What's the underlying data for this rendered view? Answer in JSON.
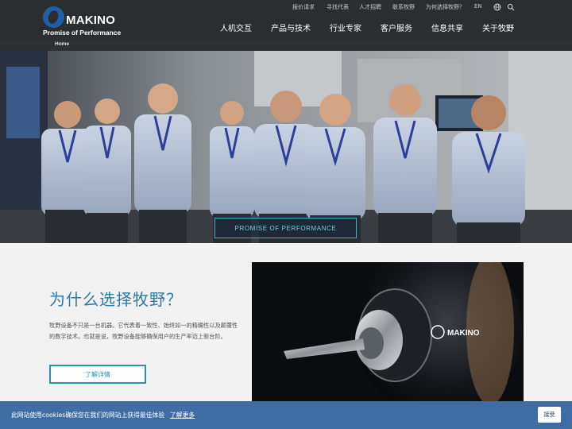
{
  "header": {
    "logo_word": "MAKINO",
    "logo_tagline": "Promise of Performance",
    "utility_links": [
      "报价请求",
      "寻找代表",
      "人才招聘",
      "联系牧野",
      "为何选择牧野？"
    ],
    "language": "EN",
    "main_nav": [
      "人机交互",
      "产品与技术",
      "行业专家",
      "客户服务",
      "信息共享",
      "关于牧野"
    ]
  },
  "breadcrumb": {
    "home": "Home"
  },
  "hero": {
    "button_label": "PROMISE OF PERFORMANCE"
  },
  "content": {
    "title": "为什么选择牧野？",
    "body": "牧野设备不只是一台机器。它代表着一致性、始终如一的精确性以及颠覆性的数字技术。也就是说，牧野设备能够确保用户的生产率迈上新台阶。",
    "button_label": "了解详情",
    "product_brand": "MAKINO"
  },
  "cookie": {
    "text": "此网站使用cookies确保您在我们的网站上获得最佳体验",
    "link": "了解更多",
    "accept": "接受"
  },
  "colors": {
    "header_bg": "#2b2e31",
    "accent_blue": "#2c7aa8",
    "teal": "#2a93a9",
    "cookie_bg": "#3e6da4"
  }
}
